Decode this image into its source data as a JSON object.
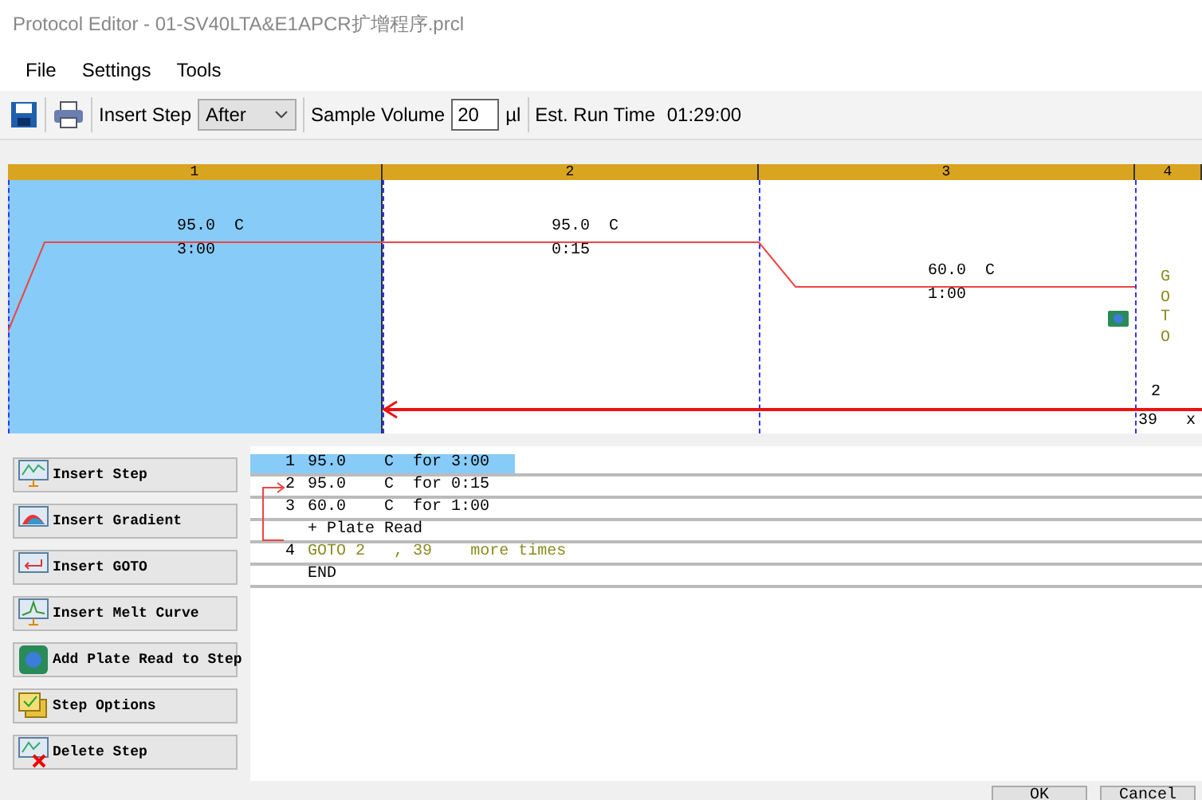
{
  "window": {
    "title": "Protocol Editor - 01-SV40LTA&E1APCR扩增程序.prcl"
  },
  "menu": [
    "File",
    "Settings",
    "Tools"
  ],
  "toolbar": {
    "insert_step_label": "Insert Step",
    "insert_step_value": "After",
    "sample_volume_label": "Sample Volume",
    "sample_volume_value": "20",
    "sample_volume_unit": "µl",
    "run_time_label": "Est. Run Time",
    "run_time_value": "01:29:00"
  },
  "graph": {
    "steps": [
      {
        "kind": "step",
        "number": "1",
        "temp": "95.0  C",
        "time": "3:00",
        "selected": true,
        "plate_read": false
      },
      {
        "kind": "step",
        "number": "2",
        "temp": "95.0  C",
        "time": "0:15",
        "selected": false,
        "plate_read": false
      },
      {
        "kind": "step",
        "number": "3",
        "temp": "60.0  C",
        "time": "1:00",
        "selected": false,
        "plate_read": true
      },
      {
        "kind": "goto",
        "number": "4",
        "label": "GOTO",
        "target": "2",
        "count": "39",
        "times_mark": "x",
        "selected": false
      }
    ]
  },
  "actions": [
    "Insert Step",
    "Insert Gradient",
    "Insert GOTO",
    "Insert Melt Curve",
    "Add Plate Read to Step",
    "Step Options",
    "Delete Step"
  ],
  "protocol": [
    {
      "kind": "step",
      "number": "1",
      "text": "95.0    C  for 3:00",
      "selected": true
    },
    {
      "kind": "step",
      "number": "2",
      "text": "95.0    C  for 0:15",
      "selected": false
    },
    {
      "kind": "step",
      "number": "3",
      "text": "60.0    C  for 1:00",
      "selected": false
    },
    {
      "kind": "plate",
      "text": "+ Plate Read",
      "selected": false
    },
    {
      "kind": "goto",
      "number": "4",
      "target": "GOTO 2",
      "count": ", 39",
      "suffix": "more times",
      "selected": false
    },
    {
      "kind": "end",
      "text": "END",
      "selected": false
    }
  ],
  "buttons": [
    "OK",
    "Cancel"
  ]
}
